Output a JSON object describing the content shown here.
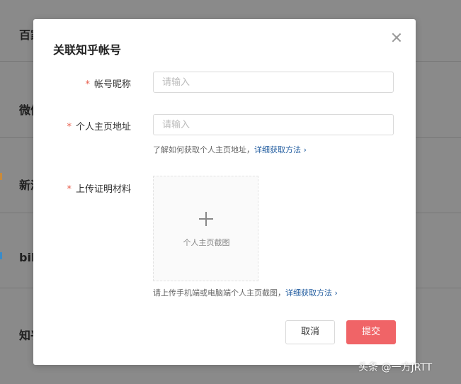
{
  "background": {
    "rows": [
      "百家",
      "微信",
      "新浪",
      "bili",
      "知乎"
    ]
  },
  "dialog": {
    "title": "关联知乎帐号",
    "fields": [
      {
        "required": "*",
        "label": "帐号昵称",
        "placeholder": "请输入"
      },
      {
        "required": "*",
        "label": "个人主页地址",
        "placeholder": "请输入"
      },
      {
        "required": "*",
        "label": "上传证明材料"
      }
    ],
    "url_hint": "了解如何获取个人主页地址，",
    "url_hint_link": "详细获取方法",
    "upload": {
      "label": "个人主页截图"
    },
    "upload_hint": "请上传手机端或电脑端个人主页截图，",
    "upload_hint_link": "详细获取方法",
    "cancel_label": "取消",
    "submit_label": "提交"
  },
  "watermark": "头条 @一方JRTT",
  "colors": {
    "accent": "#f06467",
    "link": "#1e5a9e",
    "required": "#e85c4a"
  }
}
